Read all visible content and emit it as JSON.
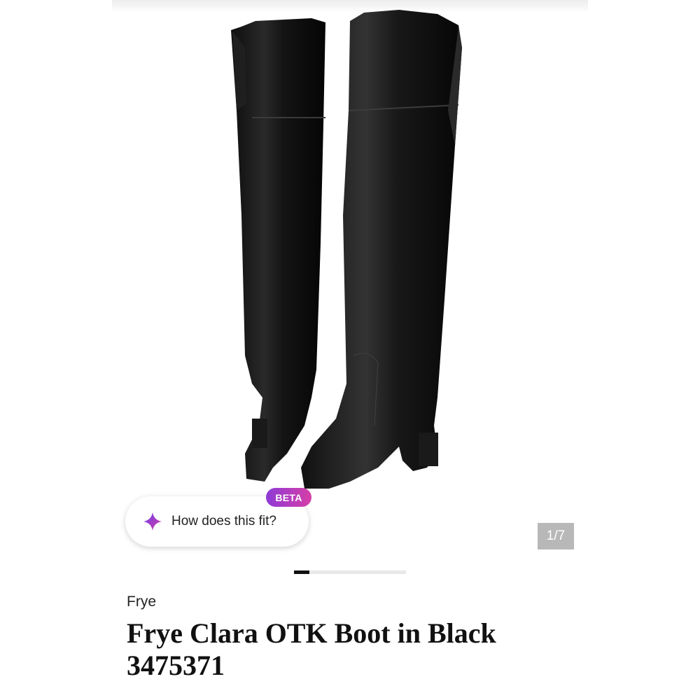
{
  "product": {
    "brand": "Frye",
    "title_line1": "Frye Clara OTK Boot in Black",
    "title_line2": "3475371"
  },
  "fit_prompt": {
    "label": "How does this fit?",
    "badge": "BETA",
    "icon": "sparkle-icon"
  },
  "gallery": {
    "counter": "1/7",
    "current": 1,
    "total": 7,
    "progress": 0.14
  },
  "colors": {
    "badge_start": "#8e3ad6",
    "badge_end": "#d63fa7",
    "counter_bg": "#b8b8b8"
  }
}
